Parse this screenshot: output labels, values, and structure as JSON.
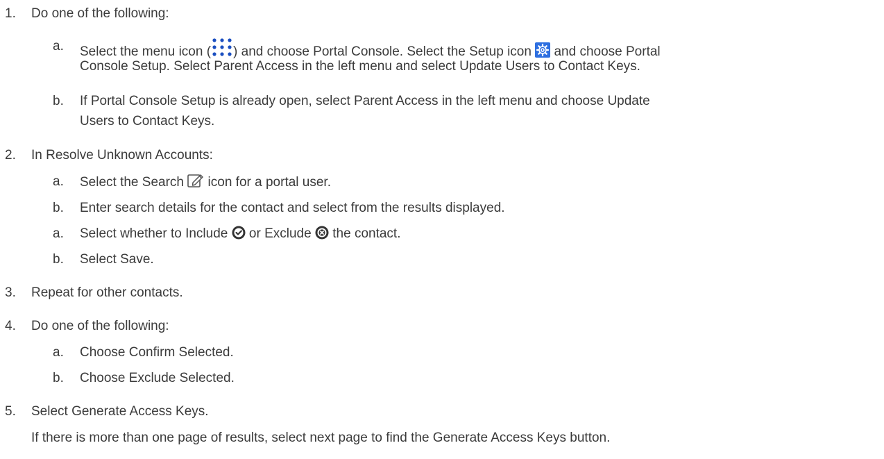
{
  "steps": [
    {
      "number": "1.",
      "text": "Do one of the following:",
      "items": [
        {
          "letter": "a.",
          "t1": "Select the menu icon (",
          "t2": ") and choose Portal Console. Select the Setup icon",
          "t3": "and choose Portal",
          "line2": "Console Setup. Select Parent Access in the left menu and select Update Users to Contact Keys."
        },
        {
          "letter": "b.",
          "line1": "If Portal Console Setup is already open, select Parent Access in the left menu and choose Update",
          "line2": "Users to Contact Keys."
        }
      ]
    },
    {
      "number": "2.",
      "text": "In Resolve Unknown Accounts:",
      "items": [
        {
          "letter": "a.",
          "t1": "Select the Search",
          "t2": "icon for a portal user."
        },
        {
          "letter": "b.",
          "text": "Enter search details for the contact and select from the results displayed."
        },
        {
          "letter": "a.",
          "t1": "Select whether to Include",
          "t2": "or Exclude",
          "t3": "the contact."
        },
        {
          "letter": "b.",
          "text": "Select Save."
        }
      ]
    },
    {
      "number": "3.",
      "text": "Repeat for other contacts."
    },
    {
      "number": "4.",
      "text": "Do one of the following:",
      "items": [
        {
          "letter": "a.",
          "text": "Choose Confirm Selected."
        },
        {
          "letter": "b.",
          "text": "Choose Exclude Selected."
        }
      ]
    },
    {
      "number": "5.",
      "text": "Select Generate Access Keys.",
      "note": "If there is more than one page of results, select next page to find the Generate Access Keys button."
    }
  ],
  "icons": {
    "menu": "menu-dots-icon",
    "setup": "setup-gear-icon",
    "search": "search-edit-icon",
    "include": "include-check-icon",
    "exclude": "exclude-x-icon"
  },
  "colors": {
    "text": "#3b3b3b",
    "menu_dots": "#1b4fc0",
    "setup_bg": "#2e6fe0",
    "circle_icon": "#333333"
  }
}
